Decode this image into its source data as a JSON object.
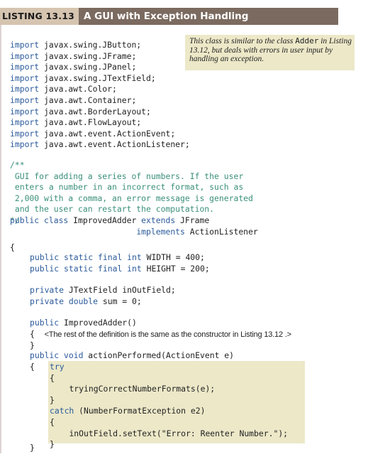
{
  "header": {
    "label": "LISTING 13.13",
    "title": "A GUI with Exception Handling",
    "colors": {
      "label_bg": "#d5c4b0",
      "title_bg": "#7b6a5f"
    }
  },
  "note": {
    "text_before": "This class is similar to the class ",
    "code_word": "Adder",
    "text_after": " in Listing 13.12, but deals with errors in user input by handling an exception."
  },
  "code": {
    "imports": [
      {
        "kw": "import",
        "rest": " javax.swing.JButton;"
      },
      {
        "kw": "import",
        "rest": " javax.swing.JFrame;"
      },
      {
        "kw": "import",
        "rest": " javax.swing.JPanel;"
      },
      {
        "kw": "import",
        "rest": " javax.swing.JTextField;"
      },
      {
        "kw": "import",
        "rest": " java.awt.Color;"
      },
      {
        "kw": "import",
        "rest": " java.awt.Container;"
      },
      {
        "kw": "import",
        "rest": " java.awt.BorderLayout;"
      },
      {
        "kw": "import",
        "rest": " java.awt.FlowLayout;"
      },
      {
        "kw": "import",
        "rest": " java.awt.event.ActionEvent;"
      },
      {
        "kw": "import",
        "rest": " java.awt.event.ActionListener;"
      }
    ],
    "comment": [
      "/**",
      " GUI for adding a series of numbers. If the user",
      " enters a number in an incorrect format, such as",
      " 2,000 with a comma, an error message is generated",
      " and the user can restart the computation.",
      "*/"
    ],
    "class_decl": {
      "kw1": "public class",
      "name": " ImprovedAdder ",
      "kw2": "extends",
      "parent": " JFrame",
      "kw3": "implements",
      "iface": " ActionListener"
    },
    "open_brace": "{",
    "close_brace": "}",
    "fields": [
      {
        "kw": "public static final int",
        "rest": " WIDTH = 400;"
      },
      {
        "kw": "public static final int",
        "rest": " HEIGHT = 200;"
      },
      {
        "kw": "private",
        "rest": " JTextField inOutField;"
      },
      {
        "kw": "private double",
        "rest": " sum = 0;"
      }
    ],
    "constructor": {
      "kw": "public",
      "rest": " ImprovedAdder()",
      "remark": "<The rest of the definition is the same as the constructor in Listing 13.12 .>"
    },
    "method": {
      "kw": "public void",
      "rest": " actionPerformed(ActionEvent e)"
    },
    "try_block": {
      "try_kw": "try",
      "try_body": "tryingCorrectNumberFormats(e);",
      "catch_kw": "catch",
      "catch_rest": " (NumberFormatException e2)",
      "catch_body": "inOutField.setText(\"Error: Reenter Number.\");"
    }
  }
}
